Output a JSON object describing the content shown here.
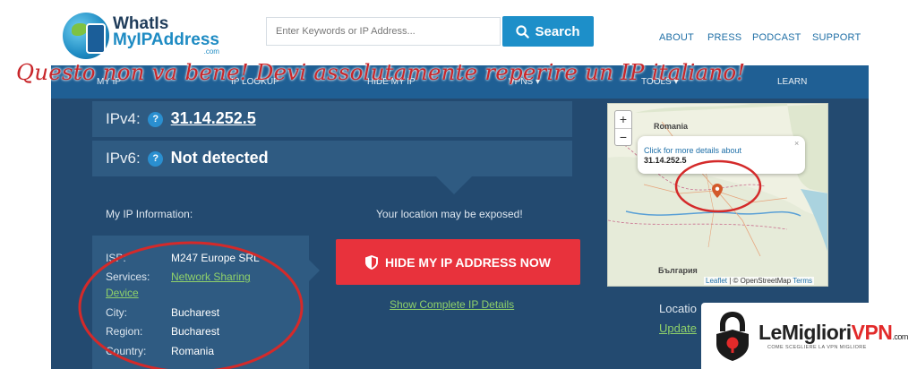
{
  "header": {
    "logo_line1": "WhatIs",
    "logo_line2": "MyIPAddress",
    "logo_sub": ".com",
    "search_placeholder": "Enter Keywords or IP Address...",
    "search_label": "Search",
    "links": [
      "ABOUT",
      "PRESS",
      "PODCAST",
      "SUPPORT"
    ]
  },
  "nav": {
    "items": [
      "MY IP",
      "IP LOOKUP",
      "HIDE MY IP",
      "VPNS ▾",
      "TOOLS ▾",
      "LEARN"
    ]
  },
  "main": {
    "ipv4_label": "IPv4:",
    "ipv4_value": "31.14.252.5",
    "ipv6_label": "IPv6:",
    "ipv6_value": "Not detected",
    "info_title": "My IP Information:",
    "info": {
      "isp_label": "ISP:",
      "isp_value": "M247 Europe SRL",
      "services_label": "Services:",
      "services_value_a": "Network Sharing",
      "services_value_b": "Device",
      "city_label": "City:",
      "city_value": "Bucharest",
      "region_label": "Region:",
      "region_value": "Bucharest",
      "country_label": "Country:",
      "country_value": "Romania"
    },
    "exposed_text": "Your location may be exposed!",
    "hide_button": "HIDE MY IP ADDRESS NOW",
    "complete_link": "Show Complete IP Details"
  },
  "map": {
    "zoom_in": "+",
    "zoom_out": "−",
    "country_north": "Romania",
    "country_south": "България",
    "popup_line1": "Click for more details about",
    "popup_line2": "31.14.252.5",
    "popup_close": "×",
    "attrib_leaflet": "Leaflet",
    "attrib_sep": " | © ",
    "attrib_osm": "OpenStreetMap",
    "attrib_terms": "Terms",
    "location_label": "Locatio",
    "update_link": "Update"
  },
  "overlay": {
    "annotation": "Questo non va bene! Devi assolutamente reperire un IP italiano!",
    "annotation_color": "#c8262a"
  },
  "badge": {
    "brand_a": "LeMigliori",
    "brand_b": "VPN",
    "brand_c": ".com",
    "tagline": "COME SCEGLIERE LA VPN MIGLIORE"
  },
  "colors": {
    "panel": "#234a70",
    "navbar": "#1f5f94",
    "hide_button": "#e8323c",
    "search_button": "#1d8fc9",
    "link_green": "#8fd16a"
  }
}
